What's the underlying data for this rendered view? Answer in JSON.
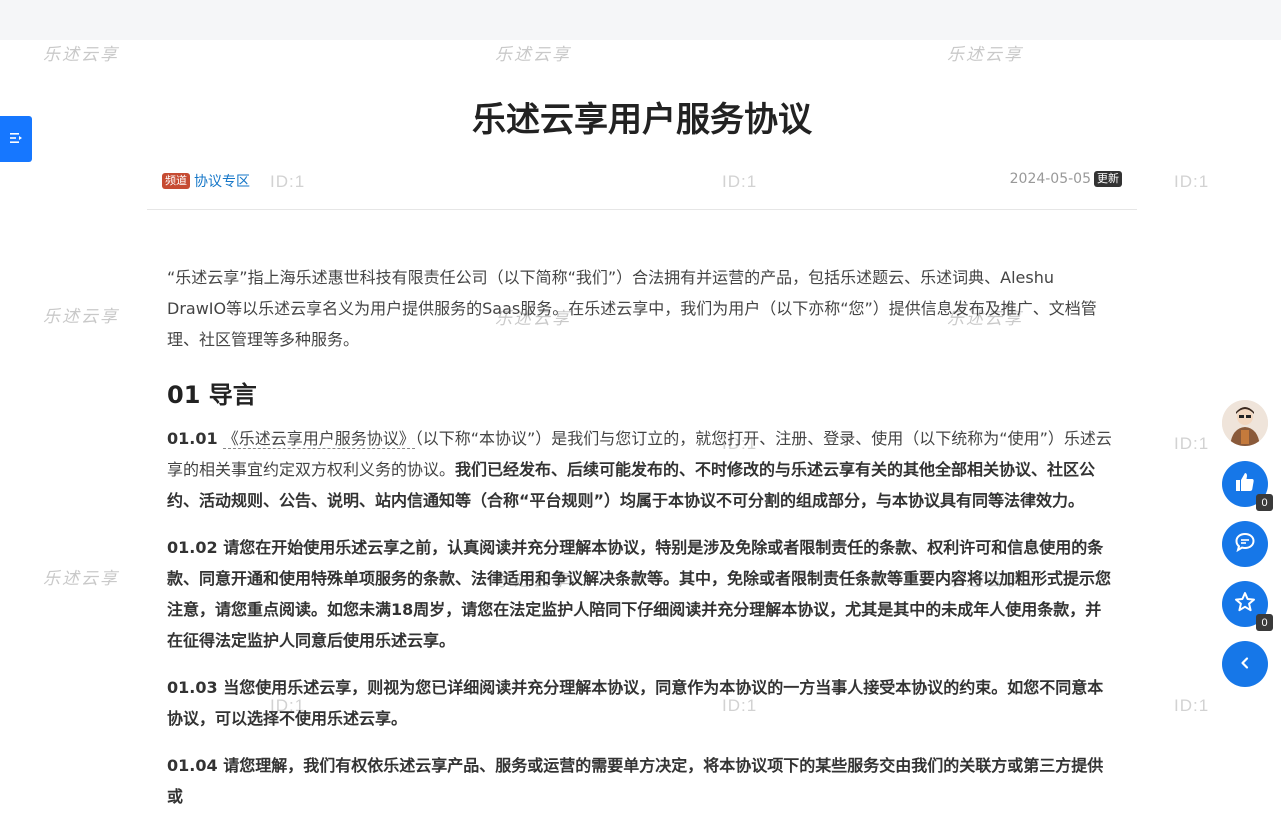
{
  "watermark_text": "乐述云享",
  "watermark_id": "ID:1",
  "toc_toggle_icon": "toc-icon",
  "article": {
    "title": "乐述云享用户服务协议",
    "channel_badge": "频道",
    "channel_name": "协议专区",
    "date": "2024-05-05",
    "updated_badge": "更新"
  },
  "body": {
    "intro": "“乐述云享”指上海乐述惠世科技有限责任公司（以下简称“我们”）合法拥有并运营的产品，包括乐述题云、乐述词典、Aleshu DrawIO等以乐述云享名义为用户提供服务的Saas服务。在乐述云享中，我们为用户（以下亦称“您”）提供信息发布及推广、文档管理、社区管理等多种服务。",
    "section_heading": "01 导言",
    "p0101_num": "01.01",
    "p0101_link": "《乐述云享用户服务协议》",
    "p0101_rest": "（以下称“本协议”）是我们与您订立的，就您打开、注册、登录、使用（以下统称为“使用”）乐述云享的相关事宜约定双方权利义务的协议。",
    "p0101_bold": "我们已经发布、后续可能发布的、不时修改的与乐述云享有关的其他全部相关协议、社区公约、活动规则、公告、说明、站内信通知等（合称“平台规则”）均属于本协议不可分割的组成部分，与本协议具有同等法律效力。",
    "p0102_num": "01.02",
    "p0102_text": "请您在开始使用乐述云享之前，认真阅读并充分理解本协议，特别是涉及免除或者限制责任的条款、权利许可和信息使用的条款、同意开通和使用特殊单项服务的条款、法律适用和争议解决条款等。其中，免除或者限制责任条款等重要内容将以加粗形式提示您注意，请您重点阅读。如您未满18周岁，请您在法定监护人陪同下仔细阅读并充分理解本协议，尤其是其中的未成年人使用条款，并在征得法定监护人同意后使用乐述云享。",
    "p0103_num": "01.03",
    "p0103_text": "当您使用乐述云享，则视为您已详细阅读并充分理解本协议，同意作为本协议的一方当事人接受本协议的约束。如您不同意本协议，可以选择不使用乐述云享。",
    "p0104_num": "01.04",
    "p0104_text": "请您理解，我们有权依乐述云享产品、服务或运营的需要单方决定，将本协议项下的某些服务交由我们的关联方或第三方提供或"
  },
  "sidebar": {
    "avatar_icon": "user-avatar-icon",
    "like_icon": "thumbs-up-icon",
    "like_count": "0",
    "comment_icon": "comment-icon",
    "favorite_icon": "star-icon",
    "favorite_count": "0",
    "collapse_icon": "chevron-left-icon"
  },
  "colors": {
    "accent": "#1677e8",
    "channel_badge": "#c64b32",
    "link": "#1677c8"
  }
}
